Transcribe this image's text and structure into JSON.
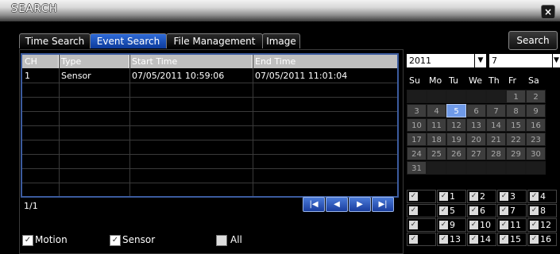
{
  "window": {
    "title": "SEARCH",
    "close_label": "×"
  },
  "tabs": [
    {
      "label": "Time Search"
    },
    {
      "label": "Event Search"
    },
    {
      "label": "File Management"
    },
    {
      "label": "Image"
    }
  ],
  "search_button": "Search",
  "table": {
    "headers": [
      "CH",
      "Type",
      "Start Time",
      "End Time"
    ],
    "rows": [
      {
        "ch": "1",
        "type": "Sensor",
        "start": "07/05/2011 10:59:06",
        "end": "07/05/2011 11:01:04"
      }
    ]
  },
  "pagination": {
    "page": "1/1",
    "first": "|◀",
    "prev": "◀",
    "next": "▶",
    "last": "▶|"
  },
  "filters": [
    {
      "label": "Motion",
      "checked": true
    },
    {
      "label": "Sensor",
      "checked": true
    },
    {
      "label": "All",
      "checked": false
    }
  ],
  "calendar": {
    "year": "2011",
    "month": "7",
    "weekdays": [
      "Su",
      "Mo",
      "Tu",
      "We",
      "Th",
      "Fr",
      "Sa"
    ],
    "weeks": [
      [
        "",
        "",
        "",
        "",
        "",
        "1",
        "2"
      ],
      [
        "3",
        "4",
        "5",
        "6",
        "7",
        "8",
        "9"
      ],
      [
        "10",
        "11",
        "12",
        "13",
        "14",
        "15",
        "16"
      ],
      [
        "17",
        "18",
        "19",
        "20",
        "21",
        "22",
        "23"
      ],
      [
        "24",
        "25",
        "26",
        "27",
        "28",
        "29",
        "30"
      ],
      [
        "31",
        "",
        "",
        "",
        "",
        "",
        ""
      ]
    ],
    "selected_day": "5"
  },
  "channels": [
    [
      "",
      "1",
      "2",
      "3",
      "4"
    ],
    [
      "",
      "5",
      "6",
      "7",
      "8"
    ],
    [
      "",
      "9",
      "10",
      "11",
      "12"
    ],
    [
      "",
      "13",
      "14",
      "15",
      "16"
    ]
  ],
  "colors": {
    "accent": "#2f6bd8",
    "selected_day": "#6f9ae8",
    "header_bg": "#bfbfbf"
  }
}
